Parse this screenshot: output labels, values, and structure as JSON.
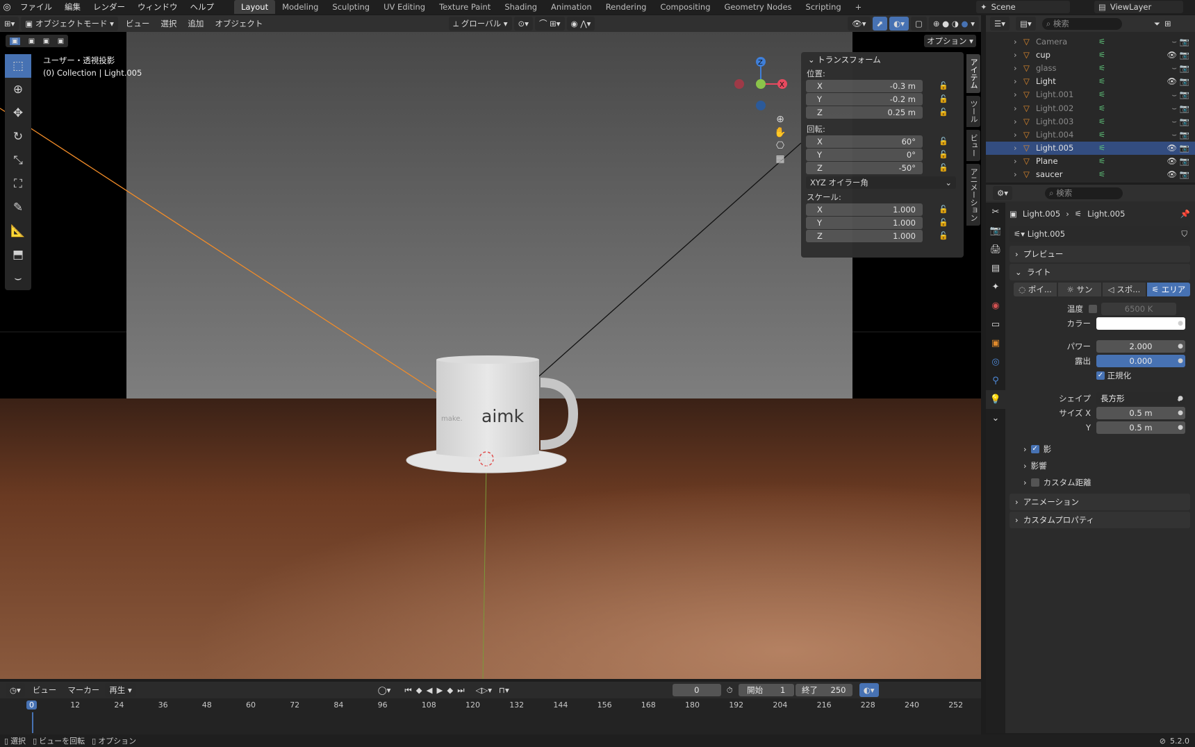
{
  "topbar": {
    "menus": [
      "ファイル",
      "編集",
      "レンダー",
      "ウィンドウ",
      "ヘルプ"
    ],
    "workspaces": [
      "Layout",
      "Modeling",
      "Sculpting",
      "UV Editing",
      "Texture Paint",
      "Shading",
      "Animation",
      "Rendering",
      "Compositing",
      "Geometry Nodes",
      "Scripting"
    ],
    "add_tab": "+",
    "scene": "Scene",
    "view_layer": "ViewLayer"
  },
  "viewport_header": {
    "mode": "オブジェクトモード",
    "menus": [
      "ビュー",
      "選択",
      "追加",
      "オブジェクト"
    ],
    "orientation": "グローバル",
    "options": "オプション"
  },
  "viewport": {
    "view_name": "ユーザー・透視投影",
    "context": "(0) Collection | Light.005",
    "mug_text_left": "make.",
    "mug_text_right": "aimk",
    "gizmo": {
      "z": "Z",
      "x": "X"
    }
  },
  "colors": {
    "accent": "#4772b3",
    "selected_row": "#334d80",
    "light_line": "#f28c28",
    "axis_x": "#e84a5f",
    "axis_y": "#8bc34a",
    "axis_z": "#3f7fd9"
  },
  "transform_panel": {
    "title": "トランスフォーム",
    "location_label": "位置:",
    "location": [
      {
        "axis": "X",
        "value": "-0.3 m"
      },
      {
        "axis": "Y",
        "value": "-0.2 m"
      },
      {
        "axis": "Z",
        "value": "0.25 m"
      }
    ],
    "rotation_label": "回転:",
    "rotation": [
      {
        "axis": "X",
        "value": "60°"
      },
      {
        "axis": "Y",
        "value": "0°"
      },
      {
        "axis": "Z",
        "value": "-50°"
      }
    ],
    "rotation_mode": "XYZ オイラー角",
    "scale_label": "スケール:",
    "scale": [
      {
        "axis": "X",
        "value": "1.000"
      },
      {
        "axis": "Y",
        "value": "1.000"
      },
      {
        "axis": "Z",
        "value": "1.000"
      }
    ],
    "side_tabs": [
      "アイテム",
      "ツール",
      "ビュー",
      "アニメーション"
    ]
  },
  "outliner": {
    "search_placeholder": "検索",
    "items": [
      {
        "name": "Camera",
        "dim": true
      },
      {
        "name": "cup",
        "dim": false
      },
      {
        "name": "glass",
        "dim": true
      },
      {
        "name": "Light",
        "dim": false
      },
      {
        "name": "Light.001",
        "dim": true
      },
      {
        "name": "Light.002",
        "dim": true
      },
      {
        "name": "Light.003",
        "dim": true
      },
      {
        "name": "Light.004",
        "dim": true
      },
      {
        "name": "Light.005",
        "dim": false,
        "selected": true
      },
      {
        "name": "Plane",
        "dim": false
      },
      {
        "name": "saucer",
        "dim": false
      }
    ]
  },
  "properties": {
    "search_placeholder": "検索",
    "breadcrumb_object": "Light.005",
    "breadcrumb_data": "Light.005",
    "datablock": "Light.005",
    "preview": "プレビュー",
    "light_section": "ライト",
    "light_types": [
      "ポイ...",
      "サン",
      "スポ...",
      "エリア"
    ],
    "temperature_label": "温度",
    "temperature_value": "6500 K",
    "color_label": "カラー",
    "power_label": "パワー",
    "power_value": "2.000",
    "exposure_label": "露出",
    "exposure_value": "0.000",
    "normalize_label": "正規化",
    "shape_label": "シェイプ",
    "shape_value": "長方形",
    "size_x_label": "サイズ X",
    "size_x_value": "0.5 m",
    "size_y_label": "Y",
    "size_y_value": "0.5 m",
    "shadow": "影",
    "influence": "影響",
    "custom_distance": "カスタム距離",
    "animation": "アニメーション",
    "custom_props": "カスタムプロパティ"
  },
  "timeline": {
    "menus": [
      "ビュー",
      "マーカー",
      "再生"
    ],
    "current_frame": "0",
    "start_label": "開始",
    "start_value": "1",
    "end_label": "終了",
    "end_value": "250",
    "ticks": [
      "0",
      "12",
      "24",
      "36",
      "48",
      "60",
      "72",
      "84",
      "96",
      "108",
      "120",
      "132",
      "144",
      "156",
      "168",
      "180",
      "192",
      "204",
      "216",
      "228",
      "240",
      "252"
    ]
  },
  "statusbar": {
    "select": "選択",
    "rotate_view": "ビューを回転",
    "options": "オプション",
    "version": "5.2.0"
  }
}
